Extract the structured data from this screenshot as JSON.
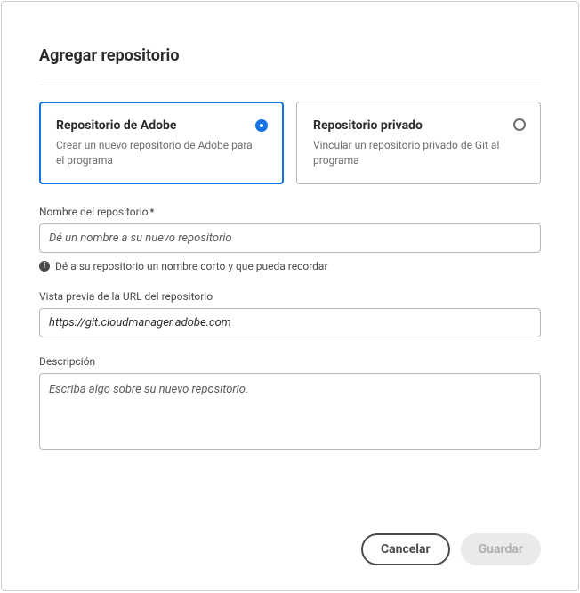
{
  "dialog": {
    "title": "Agregar repositorio"
  },
  "options": {
    "adobe": {
      "title": "Repositorio de Adobe",
      "desc": "Crear un nuevo repositorio de Adobe para el programa"
    },
    "private": {
      "title": "Repositorio privado",
      "desc": "Vincular un repositorio privado de Git al programa"
    }
  },
  "fields": {
    "name": {
      "label": "Nombre del repositorio",
      "placeholder": "Dé un nombre a su nuevo repositorio",
      "hint": "Dé a su repositorio un nombre corto y que pueda recordar"
    },
    "url": {
      "label": "Vista previa de la URL del repositorio",
      "value": "https://git.cloudmanager.adobe.com"
    },
    "description": {
      "label": "Descripción",
      "placeholder": "Escriba algo sobre su nuevo repositorio."
    }
  },
  "buttons": {
    "cancel": "Cancelar",
    "save": "Guardar"
  }
}
